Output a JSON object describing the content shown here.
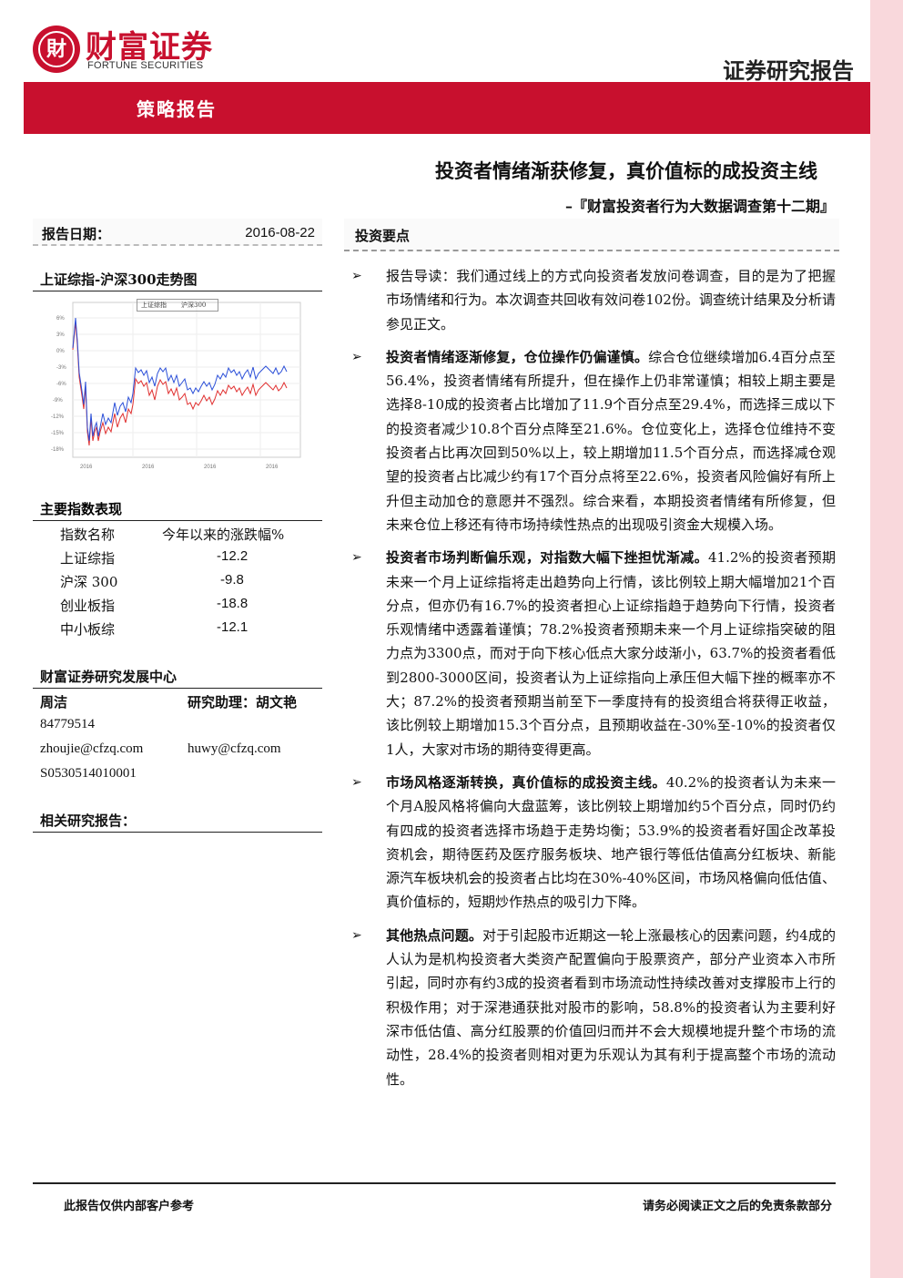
{
  "brand": {
    "logo_char": "財",
    "name_cn": "财富证券",
    "name_en": "FORTUNE SECURITIES",
    "report_type": "证券研究报告",
    "color": "#c8102e"
  },
  "band": {
    "label": "策略报告"
  },
  "title": "投资者情绪渐获修复，真价值标的成投资主线",
  "subtitle": "–『财富投资者行为大数据调查第十二期』",
  "left": {
    "date_label": "报告日期：",
    "date_value": "2016-08-22",
    "chart_title": "上证综指-沪深300走势图",
    "index_title": "主要指数表现",
    "index_header": {
      "name": "指数名称",
      "value": "今年以来的涨跌幅%"
    },
    "indices": [
      {
        "name": "上证综指",
        "value": "-12.2"
      },
      {
        "name": "沪深 300",
        "value": "-9.8"
      },
      {
        "name": "创业板指",
        "value": "-18.8"
      },
      {
        "name": "中小板综",
        "value": "-12.1"
      }
    ],
    "center": "财富证券研究发展中心",
    "analyst": "周洁",
    "assistant": "研究助理：胡文艳",
    "phone": "84779514",
    "email1": "zhoujie@cfzq.com",
    "email2": "huwy@cfzq.com",
    "cert": "S0530514010001",
    "related": "相关研究报告："
  },
  "right": {
    "head": "投资要点",
    "bullets": [
      {
        "bold": "",
        "text": "报告导读：我们通过线上的方式向投资者发放问卷调查，目的是为了把握市场情绪和行为。本次调查共回收有效问卷102份。调查统计结果及分析请参见正文。"
      },
      {
        "bold": "投资者情绪逐渐修复，仓位操作仍偏谨慎。",
        "text": "综合仓位继续增加6.4百分点至56.4%，投资者情绪有所提升，但在操作上仍非常谨慎；相较上期主要是选择8-10成的投资者占比增加了11.9个百分点至29.4%，而选择三成以下的投资者减少10.8个百分点降至21.6%。仓位变化上，选择仓位维持不变投资者占比再次回到50%以上，较上期增加11.5个百分点，而选择减仓观望的投资者占比减少约有17个百分点将至22.6%，投资者风险偏好有所上升但主动加仓的意愿并不强烈。综合来看，本期投资者情绪有所修复，但未来仓位上移还有待市场持续性热点的出现吸引资金大规模入场。"
      },
      {
        "bold": "投资者市场判断偏乐观，对指数大幅下挫担忧渐减。",
        "text": "41.2%的投资者预期未来一个月上证综指将走出趋势向上行情，该比例较上期大幅增加21个百分点，但亦仍有16.7%的投资者担心上证综指趋于趋势向下行情，投资者乐观情绪中透露着谨慎；78.2%投资者预期未来一个月上证综指突破的阻力点为3300点，而对于向下核心低点大家分歧渐小，63.7%的投资者看低到2800-3000区间，投资者认为上证综指向上承压但大幅下挫的概率亦不大；87.2%的投资者预期当前至下一季度持有的投资组合将获得正收益，该比例较上期增加15.3个百分点，且预期收益在-30%至-10%的投资者仅1人，大家对市场的期待变得更高。"
      },
      {
        "bold": "市场风格逐渐转换，真价值标的成投资主线。",
        "text": "40.2%的投资者认为未来一个月A股风格将偏向大盘蓝筹，该比例较上期增加约5个百分点，同时仍约有四成的投资者选择市场趋于走势均衡；53.9%的投资者看好国企改革投资机会，期待医药及医疗服务板块、地产银行等低估值高分红板块、新能源汽车板块机会的投资者占比均在30%-40%区间，市场风格偏向低估值、真价值标的，短期炒作热点的吸引力下降。"
      },
      {
        "bold": "其他热点问题。",
        "text": "对于引起股市近期这一轮上涨最核心的因素问题，约4成的人认为是机构投资者大类资产配置偏向于股票资产，部分产业资本入市所引起，同时亦有约3成的投资者看到市场流动性持续改善对支撑股市上行的积极作用；对于深港通获批对股市的影响，58.8%的投资者认为主要利好深市低估值、高分红股票的价值回归而并不会大规模地提升整个市场的流动性，28.4%的投资者则相对更为乐观认为其有利于提高整个市场的流动性。"
      }
    ]
  },
  "footer": {
    "left": "此报告仅供内部客户参考",
    "right": "请务必阅读正文之后的免责条款部分"
  }
}
